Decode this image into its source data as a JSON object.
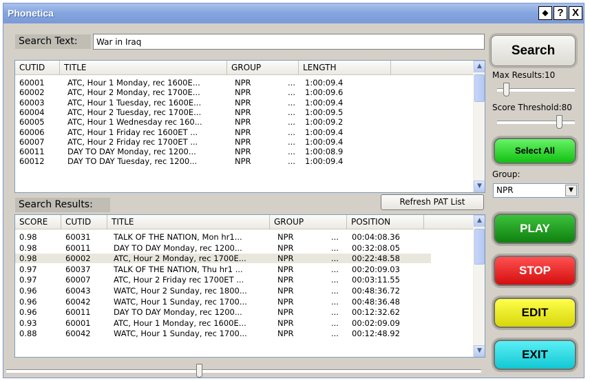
{
  "window": {
    "title": "Phonetica",
    "btn_pin": "◆",
    "btn_help": "?",
    "btn_close": "X"
  },
  "search": {
    "label": "Search Text:",
    "value": "War in Iraq",
    "button": "Search"
  },
  "sidebar": {
    "max_results_label": "Max Results:10",
    "max_results_value": 10,
    "score_threshold_label": "Score Threshold:80",
    "score_threshold_value": 80,
    "select_all": "Select All",
    "group_label": "Group:",
    "group_value": "NPR",
    "play": "PLAY",
    "stop": "STOP",
    "edit": "EDIT",
    "exit": "EXIT"
  },
  "pat_list": {
    "columns": [
      "CUTID",
      "TITLE",
      "GROUP",
      "LENGTH"
    ],
    "rows": [
      {
        "cutid": "60001",
        "title": "ATC, Hour 1 Monday, rec 1600E...",
        "group": "NPR",
        "more": "...",
        "length": "1:00:09.4"
      },
      {
        "cutid": "60002",
        "title": "ATC, Hour 2 Monday, rec 1700E...",
        "group": "NPR",
        "more": "...",
        "length": "1:00:09.6"
      },
      {
        "cutid": "60003",
        "title": "ATC, Hour 1 Tuesday, rec 1600E...",
        "group": "NPR",
        "more": "...",
        "length": "1:00:09.4"
      },
      {
        "cutid": "60004",
        "title": "ATC, Hour 2 Tuesday, rec 1700E...",
        "group": "NPR",
        "more": "...",
        "length": "1:00:09.5"
      },
      {
        "cutid": "60005",
        "title": "ATC, Hour 1 Wednesday rec 160...",
        "group": "NPR",
        "more": "...",
        "length": "1:00:09.2"
      },
      {
        "cutid": "60006",
        "title": "ATC, Hour 1 Friday rec 1600ET  ...",
        "group": "NPR",
        "more": "...",
        "length": "1:00:09.4"
      },
      {
        "cutid": "60007",
        "title": "ATC, Hour 2 Friday rec 1700ET  ...",
        "group": "NPR",
        "more": "...",
        "length": "1:00:09.4"
      },
      {
        "cutid": "60011",
        "title": "DAY TO DAY Monday, rec 1200...",
        "group": "NPR",
        "more": "...",
        "length": "1:00:08.9"
      },
      {
        "cutid": "60012",
        "title": "DAY TO DAY Tuesday, rec 1200...",
        "group": "NPR",
        "more": "...",
        "length": "1:00:09.4"
      }
    ]
  },
  "results": {
    "label": "Search Results:",
    "refresh_button": "Refresh PAT List",
    "columns": [
      "SCORE",
      "CUTID",
      "TITLE",
      "GROUP",
      "POSITION"
    ],
    "rows": [
      {
        "score": "0.98",
        "cutid": "60031",
        "title": "TALK OF THE NATION, Mon hr1...",
        "group": "NPR",
        "more": "...",
        "position": "00:04:08.36"
      },
      {
        "score": "0.98",
        "cutid": "60011",
        "title": "DAY TO DAY Monday, rec 1200...",
        "group": "NPR",
        "more": "...",
        "position": "00:32:08.05"
      },
      {
        "score": "0.98",
        "cutid": "60002",
        "title": "ATC, Hour 2 Monday, rec 1700E...",
        "group": "NPR",
        "more": "...",
        "position": "00:22:48.58"
      },
      {
        "score": "0.97",
        "cutid": "60037",
        "title": "TALK OF THE NATION, Thu hr1 ...",
        "group": "NPR",
        "more": "...",
        "position": "00:20:09.03"
      },
      {
        "score": "0.97",
        "cutid": "60007",
        "title": "ATC, Hour 2 Friday rec 1700ET  ...",
        "group": "NPR",
        "more": "...",
        "position": "00:03:11.55"
      },
      {
        "score": "0.96",
        "cutid": "60043",
        "title": "WATC, Hour 2 Sunday, rec 1800...",
        "group": "NPR",
        "more": "...",
        "position": "00:48:36.72"
      },
      {
        "score": "0.96",
        "cutid": "60042",
        "title": "WATC, Hour 1 Sunday, rec 1700...",
        "group": "NPR",
        "more": "...",
        "position": "00:48:36.48"
      },
      {
        "score": "0.96",
        "cutid": "60011",
        "title": "DAY TO DAY Monday, rec 1200...",
        "group": "NPR",
        "more": "...",
        "position": "00:12:32.62"
      },
      {
        "score": "0.93",
        "cutid": "60001",
        "title": "ATC, Hour 1 Monday, rec 1600E...",
        "group": "NPR",
        "more": "...",
        "position": "00:02:09.09"
      },
      {
        "score": "0.88",
        "cutid": "60042",
        "title": "WATC, Hour 1 Sunday, rec 1700...",
        "group": "NPR",
        "more": "...",
        "position": "00:12:48.92"
      }
    ],
    "selected_index": 2
  },
  "colors": {
    "title_bar": "#86a6e0",
    "select_all": "#22cc22",
    "play": "#1d9b1d",
    "stop": "#e11b1b",
    "edit": "#e6e61a",
    "exit": "#1ed6de"
  },
  "icons": {
    "scroll_up": "chevron-up-icon",
    "scroll_down": "chevron-down-icon",
    "dropdown": "triangle-down-icon"
  }
}
